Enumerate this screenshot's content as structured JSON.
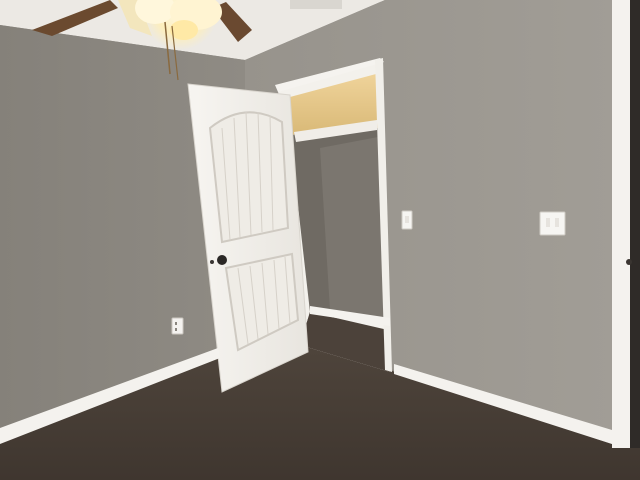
{
  "scene": {
    "subject": "empty-bedroom",
    "colors": {
      "wall": "#8c8881",
      "wall_light": "#a6a29b",
      "ceiling": "#e9e7e2",
      "carpet": "#4a4038",
      "trim": "#f4f2ee",
      "closet_interior": "#736e67",
      "closet_light": "#e8c98a",
      "fan_blade": "#6b4a2f",
      "fan_glow": "#fff2c4"
    },
    "elements": [
      "ceiling-fan",
      "closet-door",
      "closet-opening",
      "closet-shelf",
      "light-switch",
      "double-light-switch",
      "wall-outlet",
      "baseboard",
      "carpet",
      "doorway-frame-right"
    ]
  }
}
